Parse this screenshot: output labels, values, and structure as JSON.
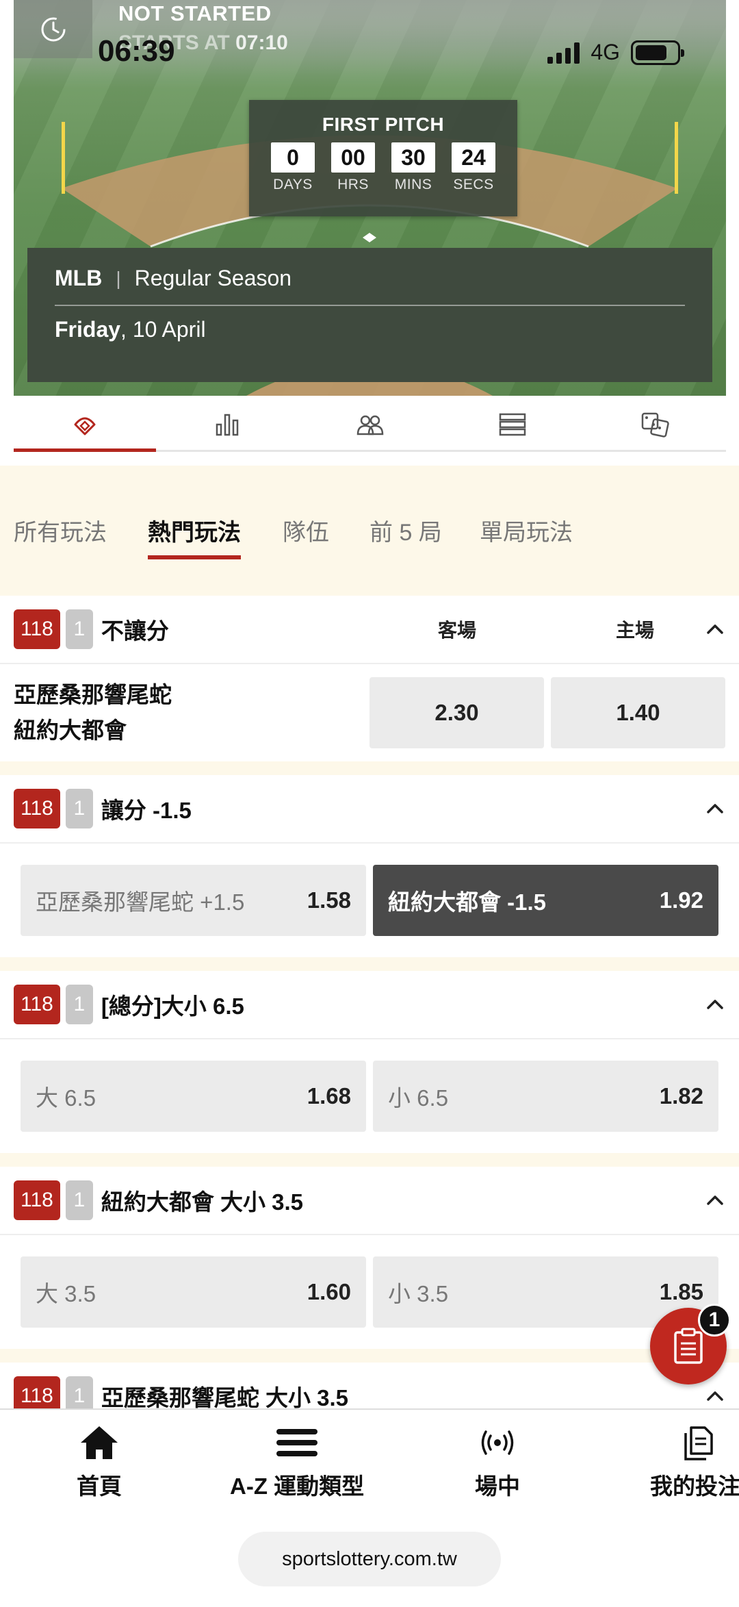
{
  "status_bar": {
    "time": "06:39",
    "network": "4G"
  },
  "hero": {
    "status": "NOT STARTED",
    "starts_at_label": "STARTS AT",
    "starts_at_value": "07:10",
    "first_pitch_title": "FIRST PITCH",
    "countdown": [
      {
        "value": "0",
        "label": "DAYS"
      },
      {
        "value": "00",
        "label": "HRS"
      },
      {
        "value": "30",
        "label": "MINS"
      },
      {
        "value": "24",
        "label": "SECS"
      }
    ],
    "league": "MLB",
    "separator": "|",
    "season": "Regular Season",
    "day": "Friday",
    "date": ", 10 April"
  },
  "icon_tabs": [
    "baseball-field-icon",
    "stats-bar-icon",
    "teams-icon",
    "list-icon",
    "dice-icon"
  ],
  "market_tabs": [
    {
      "label": "所有玩法",
      "active": false
    },
    {
      "label": "熱門玩法",
      "active": true
    },
    {
      "label": "隊伍",
      "active": false
    },
    {
      "label": "前 5 局",
      "active": false
    },
    {
      "label": "單局玩法",
      "active": false
    }
  ],
  "markets": [
    {
      "code": "118",
      "count": "1",
      "title": "不讓分",
      "col_away": "客場",
      "col_home": "主場",
      "team_away": "亞歷桑那響尾蛇",
      "team_home": "紐約大都會",
      "odd_away": "2.30",
      "odd_home": "1.40"
    },
    {
      "code": "118",
      "count": "1",
      "title": "讓分 -1.5",
      "sel_a_label": "亞歷桑那響尾蛇 +1.5",
      "sel_a_odd": "1.58",
      "sel_b_label": "紐約大都會 -1.5",
      "sel_b_odd": "1.92"
    },
    {
      "code": "118",
      "count": "1",
      "title": "[總分]大小 6.5",
      "sel_a_label": "大 6.5",
      "sel_a_odd": "1.68",
      "sel_b_label": "小 6.5",
      "sel_b_odd": "1.82"
    },
    {
      "code": "118",
      "count": "1",
      "title": "紐約大都會 大小 3.5",
      "sel_a_label": "大 3.5",
      "sel_a_odd": "1.60",
      "sel_b_label": "小 3.5",
      "sel_b_odd": "1.85"
    },
    {
      "code": "118",
      "count": "1",
      "title": "亞歷桑那響尾蛇 大小 3.5"
    }
  ],
  "betslip_count": "1",
  "bottom_nav": {
    "home": "首頁",
    "az": "A-Z 運動類型",
    "live": "場中",
    "mybets": "我的投注"
  },
  "url": "sportslottery.com.tw",
  "colors": {
    "accent": "#b3261e",
    "selected": "#4a4a4a",
    "market_bg": "#fdf8e9"
  }
}
